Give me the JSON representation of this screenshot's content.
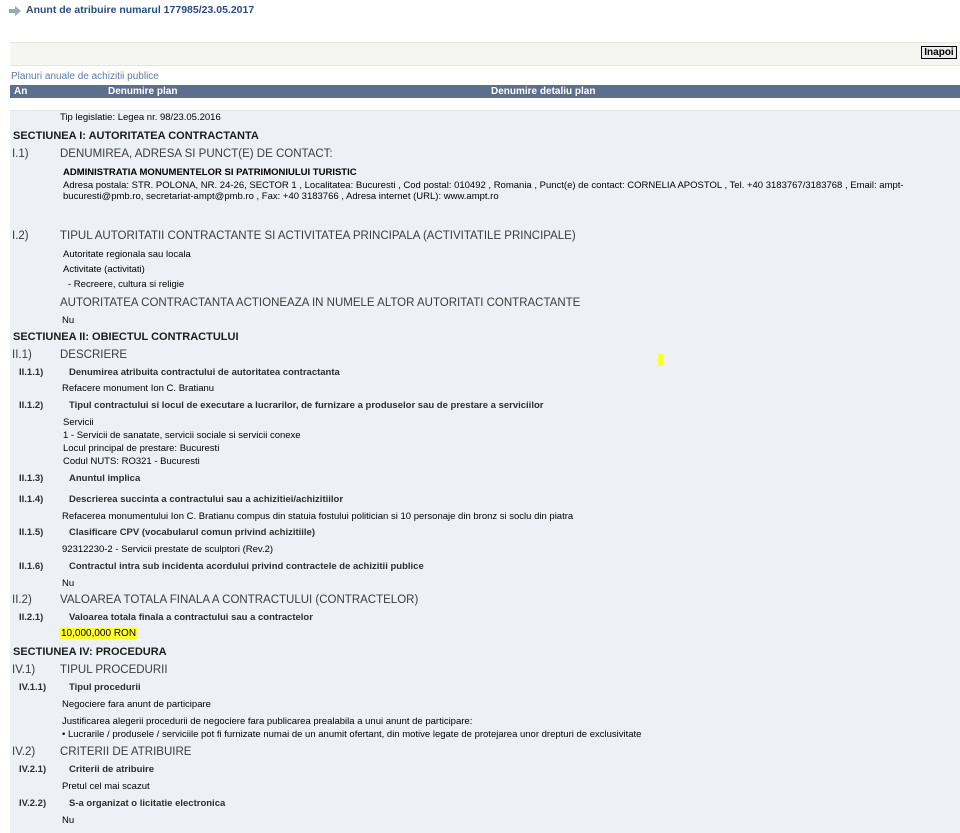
{
  "header": {
    "title": "Anunt de atribuire numarul 177985/23.05.2017",
    "icon": "arrow-right-icon",
    "back_label": "Inapoi"
  },
  "plans": {
    "title": "Planuri anuale de achizitii publice",
    "columns": [
      "An",
      "Denumire plan",
      "Denumire detaliu plan"
    ]
  },
  "legislation": "Tip legislatie: Legea nr. 98/23.05.2016",
  "s1": {
    "title": "SECTIUNEA I: AUTORITATEA CONTRACTANTA",
    "i1_num": "I.1)",
    "i1_title": "DENUMIREA, ADRESA SI PUNCT(E) DE CONTACT:",
    "authority_name": "ADMINISTRATIA MONUMENTELOR SI PATRIMONIULUI TURISTIC",
    "address_line1": "Adresa postala:  STR. POLONA, NR. 24-26, SECTOR 1 , Localitatea:  Bucuresti , Cod postal:  010492 , Romania , Punct(e) de contact:  CORNELIA APOSTOL , Tel.  +40 3183767/3183768 , Email:  ampt-",
    "address_line2": "bucuresti@pmb.ro, secretariat-ampt@pmb.ro , Fax:  +40 3183766 , Adresa internet (URL):  www.ampt.ro",
    "i2_num": "I.2)",
    "i2_title": "TIPUL AUTORITATII CONTRACTANTE SI ACTIVITATEA PRINCIPALA (ACTIVITATILE PRINCIPALE)",
    "authority_type": "Autoritate regionala sau locala",
    "activities_label": "Activitate (activitati)",
    "activity": "- Recreere, cultura si religie",
    "on_behalf_title": "AUTORITATEA CONTRACTANTA ACTIONEAZA IN NUMELE ALTOR AUTORITATI CONTRACTANTE",
    "on_behalf_value": "Nu"
  },
  "s2": {
    "title": "SECTIUNEA II: OBIECTUL CONTRACTULUI",
    "ii1_num": "II.1)",
    "ii1_title": "DESCRIERE",
    "ii111_num": "II.1.1)",
    "ii111_title": "Denumirea atribuita contractului de autoritatea contractanta",
    "ii111_value": "Refacere monument Ion C. Bratianu",
    "ii112_num": "II.1.2)",
    "ii112_title": "Tipul contractului si locul de executare a lucrarilor, de furnizare a produselor sau de prestare a serviciilor",
    "ii112_lines": [
      "Servicii",
      "1 - Servicii de sanatate, servicii sociale si servicii conexe",
      "Locul principal de prestare: Bucuresti",
      "Codul NUTS: RO321 - Bucuresti"
    ],
    "ii113_num": "II.1.3)",
    "ii113_title": "Anuntul implica",
    "ii114_num": "II.1.4)",
    "ii114_title": "Descrierea succinta a contractului sau a achizitiei/achizitiilor",
    "ii114_value": "Refacerea monumentului Ion C. Bratianu compus din statuia fostului politician si 10 personaje din bronz si soclu din piatra",
    "ii115_num": "II.1.5)",
    "ii115_title": "Clasificare CPV (vocabularul comun privind achizitiile)",
    "ii115_value": "92312230-2 - Servicii prestate de sculptori (Rev.2)",
    "ii116_num": "II.1.6)",
    "ii116_title": "Contractul intra sub incidenta acordului privind contractele de achizitii publice",
    "ii116_value": "Nu",
    "ii2_num": "II.2)",
    "ii2_title": "VALOAREA TOTALA FINALA A CONTRACTULUI (CONTRACTELOR)",
    "ii21_num": "II.2.1)",
    "ii21_title": "Valoarea totala finala a contractului sau a contractelor",
    "ii21_value": "10,000,000 RON"
  },
  "s4": {
    "title": "SECTIUNEA IV: PROCEDURA",
    "iv1_num": "IV.1)",
    "iv1_title": "TIPUL PROCEDURII",
    "iv11_num": "IV.1.1)",
    "iv11_title": "Tipul procedurii",
    "iv11_value": "Negociere fara anunt de participare",
    "justification_label": "Justificarea alegerii procedurii de negociere fara publicarea prealabila a unui anunt de participare:",
    "justification_value": "• Lucrarile / produsele / serviciile pot fi furnizate numai de un anumit ofertant, din motive legate de protejarea unor drepturi de exclusivitate",
    "iv2_num": "IV.2)",
    "iv2_title": "CRITERII DE ATRIBUIRE",
    "iv21_num": "IV.2.1)",
    "iv21_title": "Criterii de atribuire",
    "iv21_value": "Pretul cel mai scazut",
    "iv22_num": "IV.2.2)",
    "iv22_title": "S-a organizat o licitatie electronica",
    "iv22_value": "Nu"
  },
  "colors": {
    "title": "#2a4d7f",
    "table_header": "#5c6f8e",
    "panel": "#edf1f5",
    "highlight": "#ffff2e"
  }
}
